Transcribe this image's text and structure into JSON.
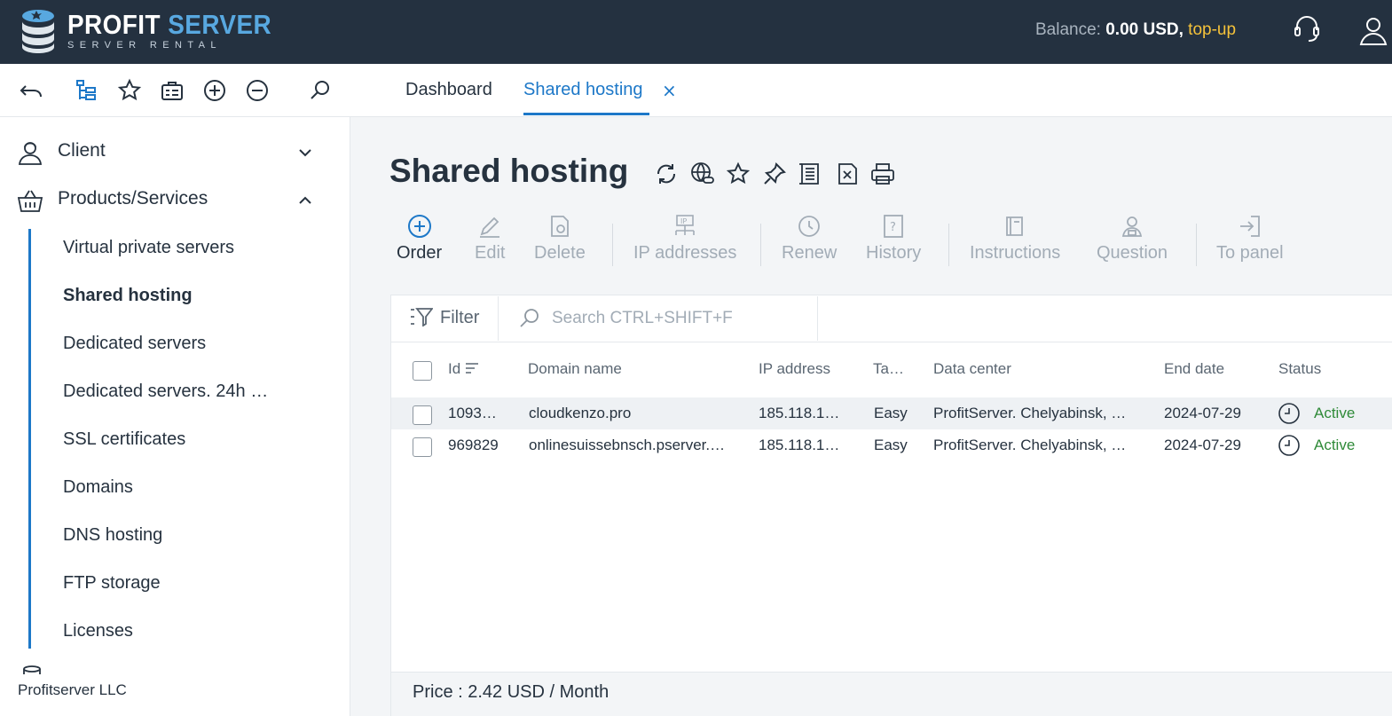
{
  "brand": {
    "title_main": "PROFIT",
    "title_accent": "SERVER",
    "subtitle": "SERVER RENTAL"
  },
  "header": {
    "balance_label": "Balance:",
    "balance_amount": "0.00 USD,",
    "topup_label": "top-up"
  },
  "tabs": [
    {
      "label": "Dashboard",
      "active": false
    },
    {
      "label": "Shared hosting",
      "active": true,
      "close": "×"
    }
  ],
  "sidebar": {
    "client_label": "Client",
    "products_label": "Products/Services",
    "items": [
      {
        "label": "Virtual private servers"
      },
      {
        "label": "Shared hosting",
        "active": true
      },
      {
        "label": "Dedicated servers"
      },
      {
        "label": "Dedicated servers. 24h …"
      },
      {
        "label": "SSL certificates"
      },
      {
        "label": "Domains"
      },
      {
        "label": "DNS hosting"
      },
      {
        "label": "FTP storage"
      },
      {
        "label": "Licenses"
      }
    ],
    "footer": "Profitserver LLC"
  },
  "page": {
    "title": "Shared hosting",
    "actions": [
      {
        "label": "Order",
        "enabled": true
      },
      {
        "label": "Edit",
        "enabled": false
      },
      {
        "label": "Delete",
        "enabled": false
      },
      {
        "label": "IP addresses",
        "enabled": false
      },
      {
        "label": "Renew",
        "enabled": false
      },
      {
        "label": "History",
        "enabled": false
      },
      {
        "label": "Instructions",
        "enabled": false
      },
      {
        "label": "Question",
        "enabled": false
      },
      {
        "label": "To panel",
        "enabled": false
      }
    ],
    "filter_label": "Filter",
    "search_placeholder": "Search CTRL+SHIFT+F"
  },
  "table": {
    "columns": [
      "Id",
      "Domain name",
      "IP address",
      "Ta…",
      "Data center",
      "End date",
      "Status"
    ],
    "rows": [
      {
        "id": "1093…",
        "domain": "cloudkenzo.pro",
        "ip": "185.118.1…",
        "tariff": "Easy",
        "datacenter": "ProfitServer. Chelyabinsk, …",
        "end_date": "2024-07-29",
        "status": "Active"
      },
      {
        "id": "969829",
        "domain": "onlinesuissebnsch.pserver.…",
        "ip": "185.118.1…",
        "tariff": "Easy",
        "datacenter": "ProfitServer. Chelyabinsk, …",
        "end_date": "2024-07-29",
        "status": "Active"
      }
    ]
  },
  "footer": {
    "price": "Price : 2.42 USD / Month"
  },
  "colors": {
    "header_bg": "#243140",
    "accent": "#1d78c8",
    "topup": "#f5c23a",
    "status_active": "#2f8a38"
  }
}
